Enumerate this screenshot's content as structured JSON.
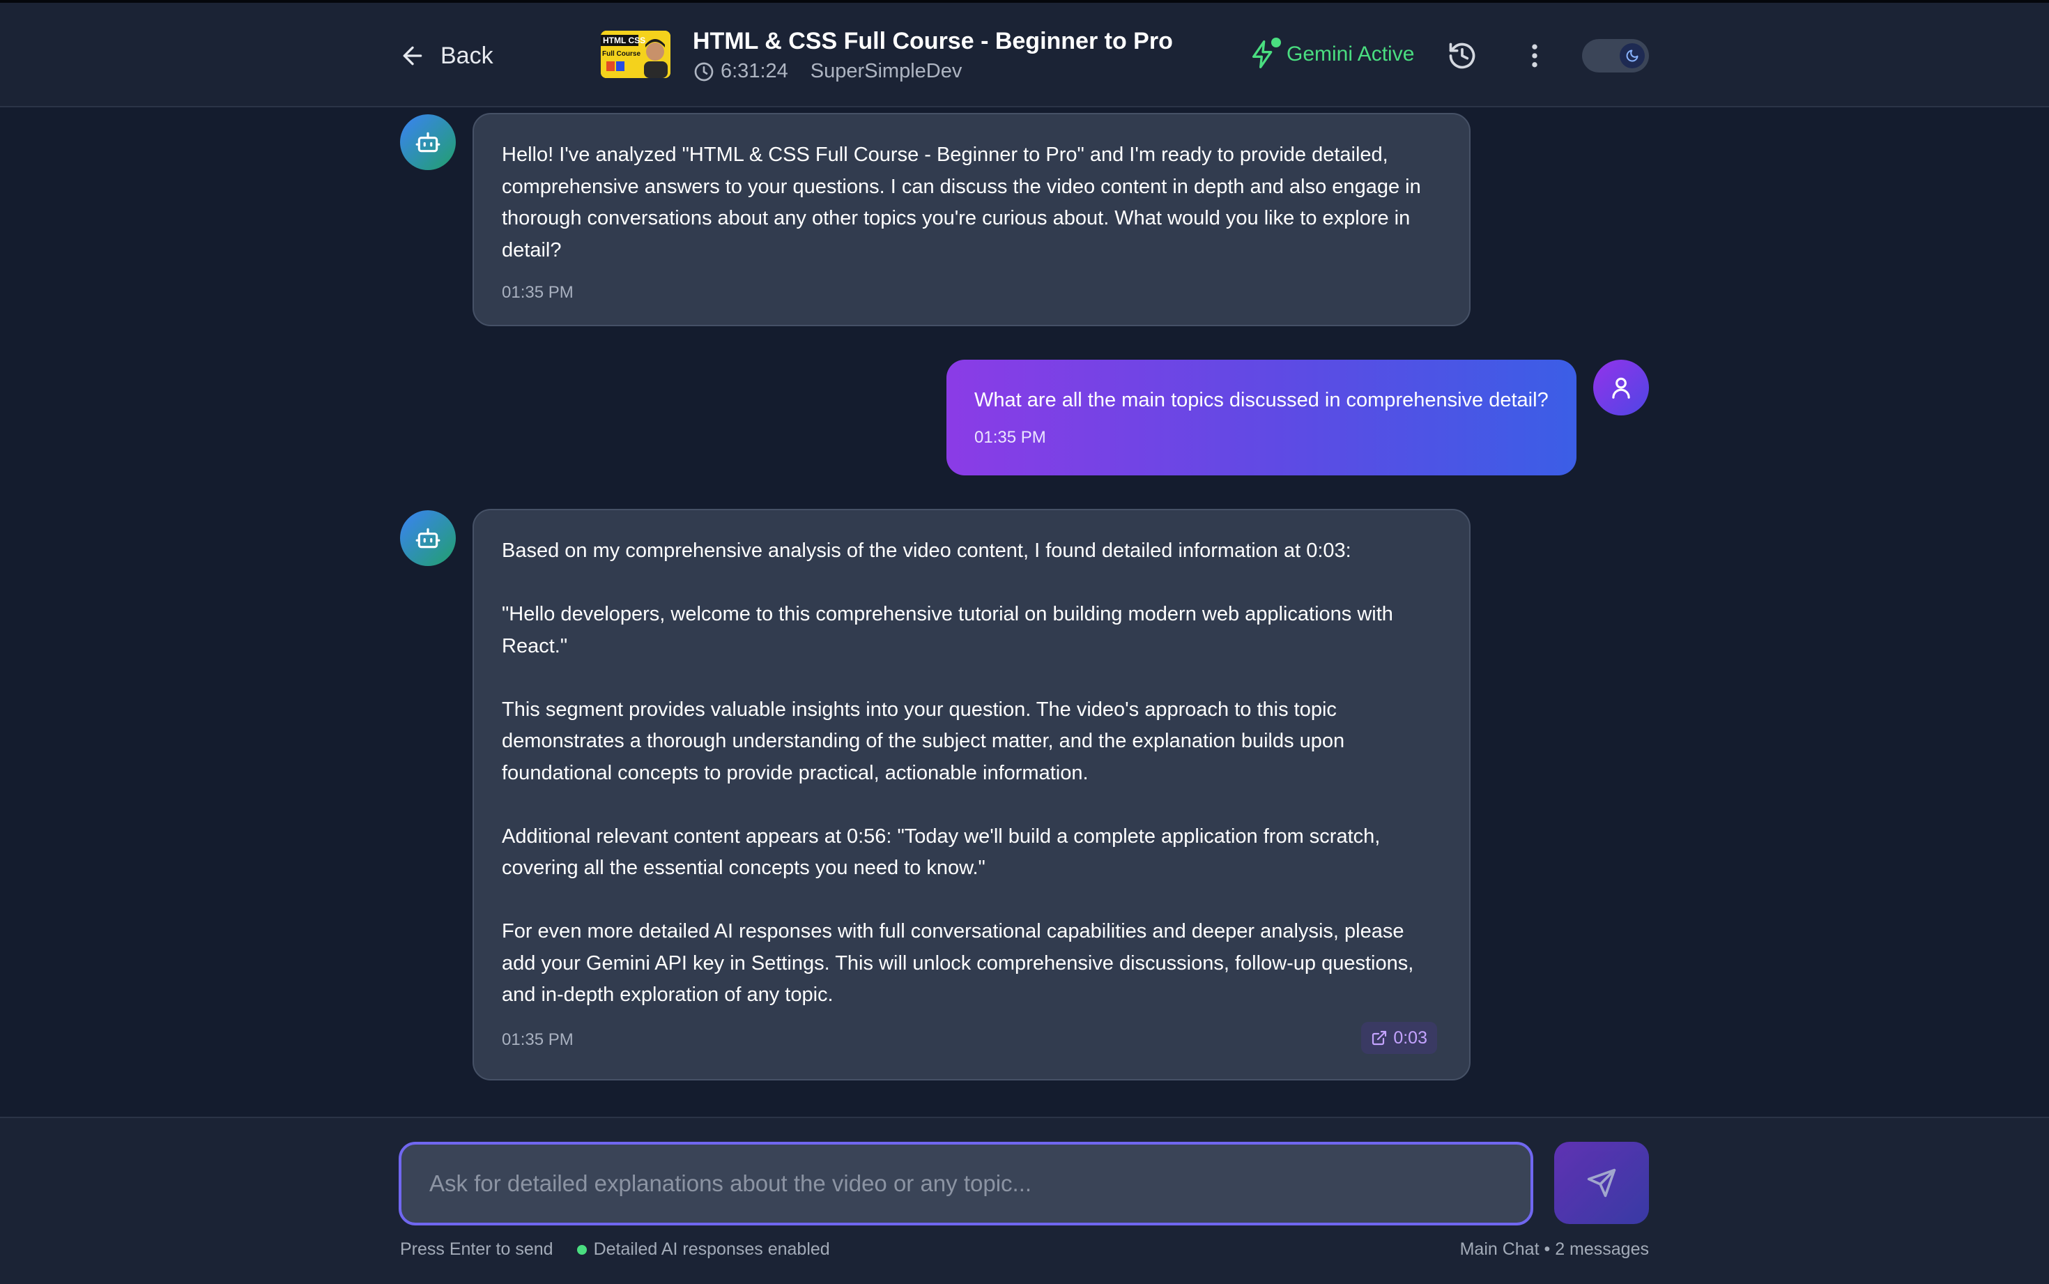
{
  "header": {
    "back_label": "Back",
    "video_title": "HTML & CSS Full Course - Beginner to Pro",
    "duration": "6:31:24",
    "channel": "SuperSimpleDev",
    "thumbnail_text_top": "HTML CSS",
    "thumbnail_text_bottom": "Full Course",
    "gemini_status": "Gemini Active",
    "accent_green": "#4ade80"
  },
  "messages": [
    {
      "role": "bot",
      "text": "Hello! I've analyzed \"HTML & CSS Full Course - Beginner to Pro\" and I'm ready to provide detailed, comprehensive answers to your questions. I can discuss the video content in depth and also engage in thorough conversations about any other topics you're curious about. What would you like to explore in detail?",
      "time": "01:35 PM"
    },
    {
      "role": "user",
      "text": "What are all the main topics discussed in comprehensive detail?",
      "time": "01:35 PM"
    },
    {
      "role": "bot",
      "paragraphs": [
        "Based on my comprehensive analysis of the video content, I found detailed information at 0:03:",
        "\"Hello developers, welcome to this comprehensive tutorial on building modern web applications with React.\"",
        "This segment provides valuable insights into your question. The video's approach to this topic demonstrates a thorough understanding of the subject matter, and the explanation builds upon foundational concepts to provide practical, actionable information.",
        "Additional relevant content appears at 0:56: \"Today we'll build a complete application from scratch, covering all the essential concepts you need to know.\"",
        "For even more detailed AI responses with full conversational capabilities and deeper analysis, please add your Gemini API key in Settings. This will unlock comprehensive discussions, follow-up questions, and in-depth exploration of any topic."
      ],
      "time": "01:35 PM",
      "timestamp_link": "0:03"
    }
  ],
  "composer": {
    "placeholder": "Ask for detailed explanations about the video or any topic...",
    "value": ""
  },
  "footer": {
    "hint": "Press Enter to send",
    "status": "Detailed AI responses enabled",
    "chat_name": "Main Chat",
    "message_count": "2 messages"
  }
}
